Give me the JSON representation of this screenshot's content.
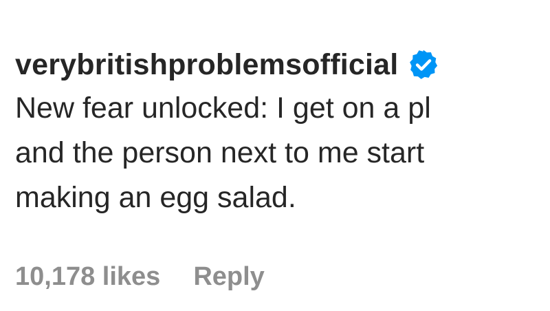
{
  "comment": {
    "username": "verybritishproblemsofficial",
    "verified_icon": "verified-badge-icon",
    "verified_color": "#0095F6",
    "text_lines": [
      "New fear unlocked: I get on a pl",
      "and the person next to me start",
      "making an egg salad."
    ],
    "likes_label": "10,178 likes",
    "reply_label": "Reply"
  }
}
